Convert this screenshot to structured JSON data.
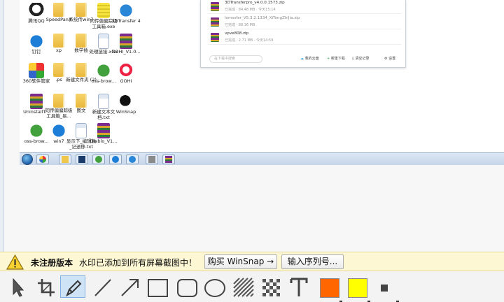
{
  "desktop": {
    "icons": [
      {
        "label": "腾讯QQ",
        "icon": "qq-icon"
      },
      {
        "label": "SpeedPanX",
        "icon": "folder-icon"
      },
      {
        "label": "系统传win7",
        "icon": "folder-icon"
      },
      {
        "label": "同传偏偏踪级工具箱.exe",
        "icon": "document-icon"
      },
      {
        "label": "3DTransfer 4",
        "icon": "transfer-icon"
      },
      {
        "label": "钉钉",
        "icon": "dingtalk-icon"
      },
      {
        "label": "xp",
        "icon": "folder-icon"
      },
      {
        "label": "数学插",
        "icon": "folder-icon"
      },
      {
        "label": "处理链接.xlsx",
        "icon": "document-icon"
      },
      {
        "label": "GOHI_V1.0...",
        "icon": "archive-icon"
      },
      {
        "label": "360软件管家",
        "icon": "app-store-icon"
      },
      {
        "label": ".ps",
        "icon": "folder-icon"
      },
      {
        "label": "新建文件夹 (2)",
        "icon": "folder-icon"
      },
      {
        "label": "oss-brow...",
        "icon": "oss-browser-icon"
      },
      {
        "label": "GOHI",
        "icon": "bird-icon"
      },
      {
        "label": "UninstallT...",
        "icon": "uninstall-icon"
      },
      {
        "label": "同传偏偏踪级工具箱_易...",
        "icon": "folder-icon"
      },
      {
        "label": "图文",
        "icon": "folder-icon"
      },
      {
        "label": "新建文本文档.txt",
        "icon": "text-file-icon"
      },
      {
        "label": "WinSnap",
        "icon": "winsnap-icon"
      },
      {
        "label": "oss-brow...",
        "icon": "oss-browser-icon"
      },
      {
        "label": "win7",
        "icon": "win7-file-icon"
      },
      {
        "label": "显示下_编辑数_记送移.txt",
        "icon": "text-file-icon"
      },
      {
        "label": "Diablo_V1...",
        "icon": "archive-icon"
      }
    ]
  },
  "download_window": {
    "items": [
      {
        "name": "3DTransferpro_v4.0.0.1573.zip",
        "meta": "已完成 · 84.48 MB · 今天15:14"
      },
      {
        "name": "lomssfer_V5.3.2.1334_XiTongZhiJia.zip",
        "meta": "已完成 · 88.36 MB"
      },
      {
        "name": "vpve808.zip",
        "meta": "已完成 · 2.71 MB · 今天14:59"
      }
    ],
    "search_placeholder": "在下载中搜索",
    "footer": {
      "my_cloud": "我的云盘",
      "new_download": "新建下载",
      "clear_records": "清空记录",
      "settings": "设置"
    }
  },
  "notice": {
    "unregistered": "未注册版本",
    "message": "水印已添加到所有屏幕截图中！",
    "buy_button": "购买 WinSnap →",
    "serial_button": "输入序列号..."
  },
  "toolbar": {
    "tools": [
      "select",
      "crop",
      "pen",
      "line",
      "arrow",
      "rectangle",
      "rounded-rectangle",
      "ellipse",
      "hatch",
      "pixelate",
      "text"
    ],
    "active_tool": "pen",
    "colors": {
      "primary": "#ff6600",
      "secondary": "#ffff00"
    }
  }
}
